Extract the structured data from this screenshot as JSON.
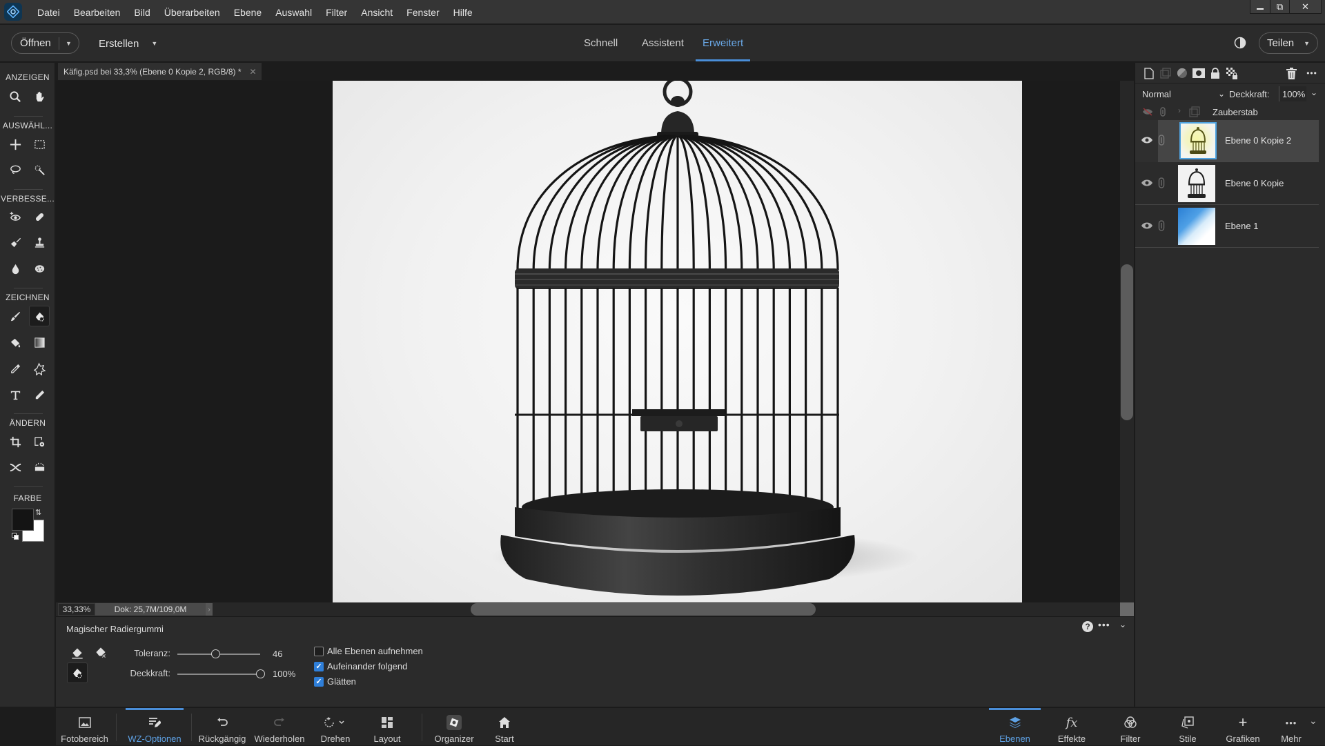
{
  "app": {
    "menu": [
      "Datei",
      "Bearbeiten",
      "Bild",
      "Überarbeiten",
      "Ebene",
      "Auswahl",
      "Filter",
      "Ansicht",
      "Fenster",
      "Hilfe"
    ],
    "window_controls": {
      "minimize": "minimize-icon",
      "restore": "restore-icon",
      "close": "close-icon"
    }
  },
  "topbar": {
    "open_label": "Öffnen",
    "create_label": "Erstellen",
    "modes": [
      {
        "label": "Schnell",
        "active": false
      },
      {
        "label": "Assistent",
        "active": false
      },
      {
        "label": "Erweitert",
        "active": true
      }
    ],
    "share_label": "Teilen"
  },
  "toolbar": {
    "sections": {
      "view": "ANZEIGEN",
      "select": "AUSWÄHL...",
      "enhance": "VERBESSE...",
      "draw": "ZEICHNEN",
      "modify": "ÄNDERN",
      "color": "FARBE"
    },
    "tools": [
      "zoom-tool",
      "hand-tool",
      "move-tool",
      "marquee-tool",
      "lasso-tool",
      "magic-wand-tool",
      "red-eye-tool",
      "spot-healing-tool",
      "smart-brush-tool",
      "clone-stamp-tool",
      "blur-tool",
      "sponge-tool",
      "brush-tool",
      "magic-eraser-tool",
      "paint-bucket-tool",
      "gradient-tool",
      "eyedropper-tool",
      "custom-shape-tool",
      "type-tool",
      "pencil-tool",
      "crop-tool",
      "recompose-tool",
      "content-aware-move-tool",
      "straighten-tool"
    ],
    "active_tool": "magic-eraser-tool",
    "foreground_color": "#141414",
    "background_color": "#ffffff"
  },
  "document": {
    "tab_title": "Käfig.psd bei 33,3% (Ebene 0 Kopie 2, RGB/8) *",
    "zoom": "33,33%",
    "doc_info": "Dok: 25,7M/109,0M"
  },
  "tool_options": {
    "tool_name": "Magischer Radiergummi",
    "tolerance_label": "Toleranz:",
    "tolerance_value": "46",
    "tolerance_fraction": 0.46,
    "opacity_label": "Deckkraft:",
    "opacity_value": "100%",
    "opacity_fraction": 1.0,
    "checkboxes": [
      {
        "label": "Alle Ebenen aufnehmen",
        "checked": false
      },
      {
        "label": "Aufeinander folgend",
        "checked": true
      },
      {
        "label": "Glätten",
        "checked": true
      }
    ]
  },
  "layers_panel": {
    "blend_mode": "Normal",
    "opacity_label": "Deckkraft:",
    "opacity_value": "100%",
    "group": {
      "name": "Zauberstab",
      "visible": false
    },
    "layers": [
      {
        "name": "Ebene 0 Kopie 2",
        "selected": true,
        "visible": true
      },
      {
        "name": "Ebene 0 Kopie",
        "selected": false,
        "visible": true
      },
      {
        "name": "Ebene 1",
        "selected": false,
        "visible": true
      }
    ]
  },
  "bottombar": {
    "left": [
      {
        "label": "Fotobereich",
        "icon": "photo-bin-icon",
        "active": false
      },
      {
        "label": "WZ-Optionen",
        "icon": "tool-options-icon",
        "active": true
      },
      {
        "label": "Rückgängig",
        "icon": "undo-icon",
        "active": false
      },
      {
        "label": "Wiederholen",
        "icon": "redo-icon",
        "active": false
      },
      {
        "label": "Drehen",
        "icon": "rotate-icon",
        "active": false
      },
      {
        "label": "Layout",
        "icon": "layout-icon",
        "active": false
      },
      {
        "label": "Organizer",
        "icon": "organizer-icon",
        "active": false
      },
      {
        "label": "Start",
        "icon": "home-icon",
        "active": false
      }
    ],
    "right": [
      {
        "label": "Ebenen",
        "icon": "layers-icon",
        "active": true
      },
      {
        "label": "Effekte",
        "icon": "effects-icon",
        "active": false
      },
      {
        "label": "Filter",
        "icon": "filter-icon",
        "active": false
      },
      {
        "label": "Stile",
        "icon": "styles-icon",
        "active": false
      },
      {
        "label": "Grafiken",
        "icon": "graphics-icon",
        "active": false
      },
      {
        "label": "Mehr",
        "icon": "more-icon",
        "active": false
      }
    ]
  }
}
